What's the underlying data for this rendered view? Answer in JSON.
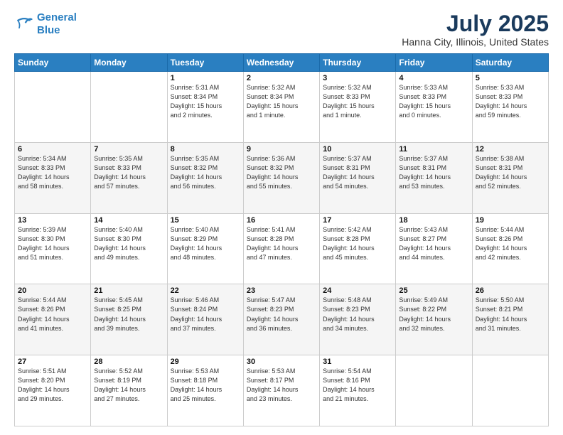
{
  "header": {
    "logo_line1": "General",
    "logo_line2": "Blue",
    "title": "July 2025",
    "subtitle": "Hanna City, Illinois, United States"
  },
  "weekdays": [
    "Sunday",
    "Monday",
    "Tuesday",
    "Wednesday",
    "Thursday",
    "Friday",
    "Saturday"
  ],
  "weeks": [
    [
      {
        "day": "",
        "info": ""
      },
      {
        "day": "",
        "info": ""
      },
      {
        "day": "1",
        "info": "Sunrise: 5:31 AM\nSunset: 8:34 PM\nDaylight: 15 hours\nand 2 minutes."
      },
      {
        "day": "2",
        "info": "Sunrise: 5:32 AM\nSunset: 8:34 PM\nDaylight: 15 hours\nand 1 minute."
      },
      {
        "day": "3",
        "info": "Sunrise: 5:32 AM\nSunset: 8:33 PM\nDaylight: 15 hours\nand 1 minute."
      },
      {
        "day": "4",
        "info": "Sunrise: 5:33 AM\nSunset: 8:33 PM\nDaylight: 15 hours\nand 0 minutes."
      },
      {
        "day": "5",
        "info": "Sunrise: 5:33 AM\nSunset: 8:33 PM\nDaylight: 14 hours\nand 59 minutes."
      }
    ],
    [
      {
        "day": "6",
        "info": "Sunrise: 5:34 AM\nSunset: 8:33 PM\nDaylight: 14 hours\nand 58 minutes."
      },
      {
        "day": "7",
        "info": "Sunrise: 5:35 AM\nSunset: 8:33 PM\nDaylight: 14 hours\nand 57 minutes."
      },
      {
        "day": "8",
        "info": "Sunrise: 5:35 AM\nSunset: 8:32 PM\nDaylight: 14 hours\nand 56 minutes."
      },
      {
        "day": "9",
        "info": "Sunrise: 5:36 AM\nSunset: 8:32 PM\nDaylight: 14 hours\nand 55 minutes."
      },
      {
        "day": "10",
        "info": "Sunrise: 5:37 AM\nSunset: 8:31 PM\nDaylight: 14 hours\nand 54 minutes."
      },
      {
        "day": "11",
        "info": "Sunrise: 5:37 AM\nSunset: 8:31 PM\nDaylight: 14 hours\nand 53 minutes."
      },
      {
        "day": "12",
        "info": "Sunrise: 5:38 AM\nSunset: 8:31 PM\nDaylight: 14 hours\nand 52 minutes."
      }
    ],
    [
      {
        "day": "13",
        "info": "Sunrise: 5:39 AM\nSunset: 8:30 PM\nDaylight: 14 hours\nand 51 minutes."
      },
      {
        "day": "14",
        "info": "Sunrise: 5:40 AM\nSunset: 8:30 PM\nDaylight: 14 hours\nand 49 minutes."
      },
      {
        "day": "15",
        "info": "Sunrise: 5:40 AM\nSunset: 8:29 PM\nDaylight: 14 hours\nand 48 minutes."
      },
      {
        "day": "16",
        "info": "Sunrise: 5:41 AM\nSunset: 8:28 PM\nDaylight: 14 hours\nand 47 minutes."
      },
      {
        "day": "17",
        "info": "Sunrise: 5:42 AM\nSunset: 8:28 PM\nDaylight: 14 hours\nand 45 minutes."
      },
      {
        "day": "18",
        "info": "Sunrise: 5:43 AM\nSunset: 8:27 PM\nDaylight: 14 hours\nand 44 minutes."
      },
      {
        "day": "19",
        "info": "Sunrise: 5:44 AM\nSunset: 8:26 PM\nDaylight: 14 hours\nand 42 minutes."
      }
    ],
    [
      {
        "day": "20",
        "info": "Sunrise: 5:44 AM\nSunset: 8:26 PM\nDaylight: 14 hours\nand 41 minutes."
      },
      {
        "day": "21",
        "info": "Sunrise: 5:45 AM\nSunset: 8:25 PM\nDaylight: 14 hours\nand 39 minutes."
      },
      {
        "day": "22",
        "info": "Sunrise: 5:46 AM\nSunset: 8:24 PM\nDaylight: 14 hours\nand 37 minutes."
      },
      {
        "day": "23",
        "info": "Sunrise: 5:47 AM\nSunset: 8:23 PM\nDaylight: 14 hours\nand 36 minutes."
      },
      {
        "day": "24",
        "info": "Sunrise: 5:48 AM\nSunset: 8:23 PM\nDaylight: 14 hours\nand 34 minutes."
      },
      {
        "day": "25",
        "info": "Sunrise: 5:49 AM\nSunset: 8:22 PM\nDaylight: 14 hours\nand 32 minutes."
      },
      {
        "day": "26",
        "info": "Sunrise: 5:50 AM\nSunset: 8:21 PM\nDaylight: 14 hours\nand 31 minutes."
      }
    ],
    [
      {
        "day": "27",
        "info": "Sunrise: 5:51 AM\nSunset: 8:20 PM\nDaylight: 14 hours\nand 29 minutes."
      },
      {
        "day": "28",
        "info": "Sunrise: 5:52 AM\nSunset: 8:19 PM\nDaylight: 14 hours\nand 27 minutes."
      },
      {
        "day": "29",
        "info": "Sunrise: 5:53 AM\nSunset: 8:18 PM\nDaylight: 14 hours\nand 25 minutes."
      },
      {
        "day": "30",
        "info": "Sunrise: 5:53 AM\nSunset: 8:17 PM\nDaylight: 14 hours\nand 23 minutes."
      },
      {
        "day": "31",
        "info": "Sunrise: 5:54 AM\nSunset: 8:16 PM\nDaylight: 14 hours\nand 21 minutes."
      },
      {
        "day": "",
        "info": ""
      },
      {
        "day": "",
        "info": ""
      }
    ]
  ]
}
